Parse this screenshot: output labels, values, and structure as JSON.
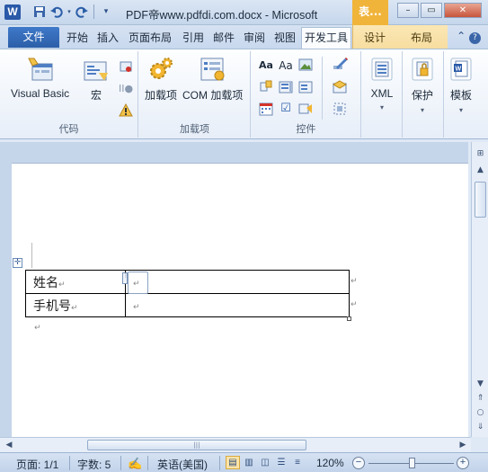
{
  "window": {
    "title": "PDF帝www.pdfdi.com.docx - Microsoft",
    "context_tab_title": "表...",
    "controls": {
      "minimize": "–",
      "restore": "▭",
      "close": "✕"
    }
  },
  "quick_access": {
    "icons": [
      "word-logo",
      "save-icon",
      "undo-icon",
      "redo-icon",
      "customize-qat-icon"
    ]
  },
  "tabs": {
    "file": "文件",
    "items": [
      "开始",
      "插入",
      "页面布局",
      "引用",
      "邮件",
      "审阅",
      "视图",
      "开发工具"
    ],
    "active": "开发工具",
    "context": [
      "设计",
      "布局"
    ]
  },
  "ribbon": {
    "code": {
      "label": "代码",
      "visual_basic": "Visual Basic",
      "macro": "宏"
    },
    "addins": {
      "label": "加载项",
      "addins_btn": "加载项",
      "com_addins_btn": "COM 加载项"
    },
    "controls": {
      "label": "控件"
    },
    "xml": {
      "label": "XML"
    },
    "protect": {
      "label": "保护"
    },
    "templates": {
      "label": "模板"
    }
  },
  "document": {
    "table": {
      "rows": [
        [
          "姓名",
          ""
        ],
        [
          "手机号",
          ""
        ]
      ],
      "cell_mark": "↵"
    },
    "paragraph_mark": "↵"
  },
  "statusbar": {
    "page": "页面: 1/1",
    "words": "字数: 5",
    "language": "英语(美国)",
    "zoom": "120%"
  }
}
